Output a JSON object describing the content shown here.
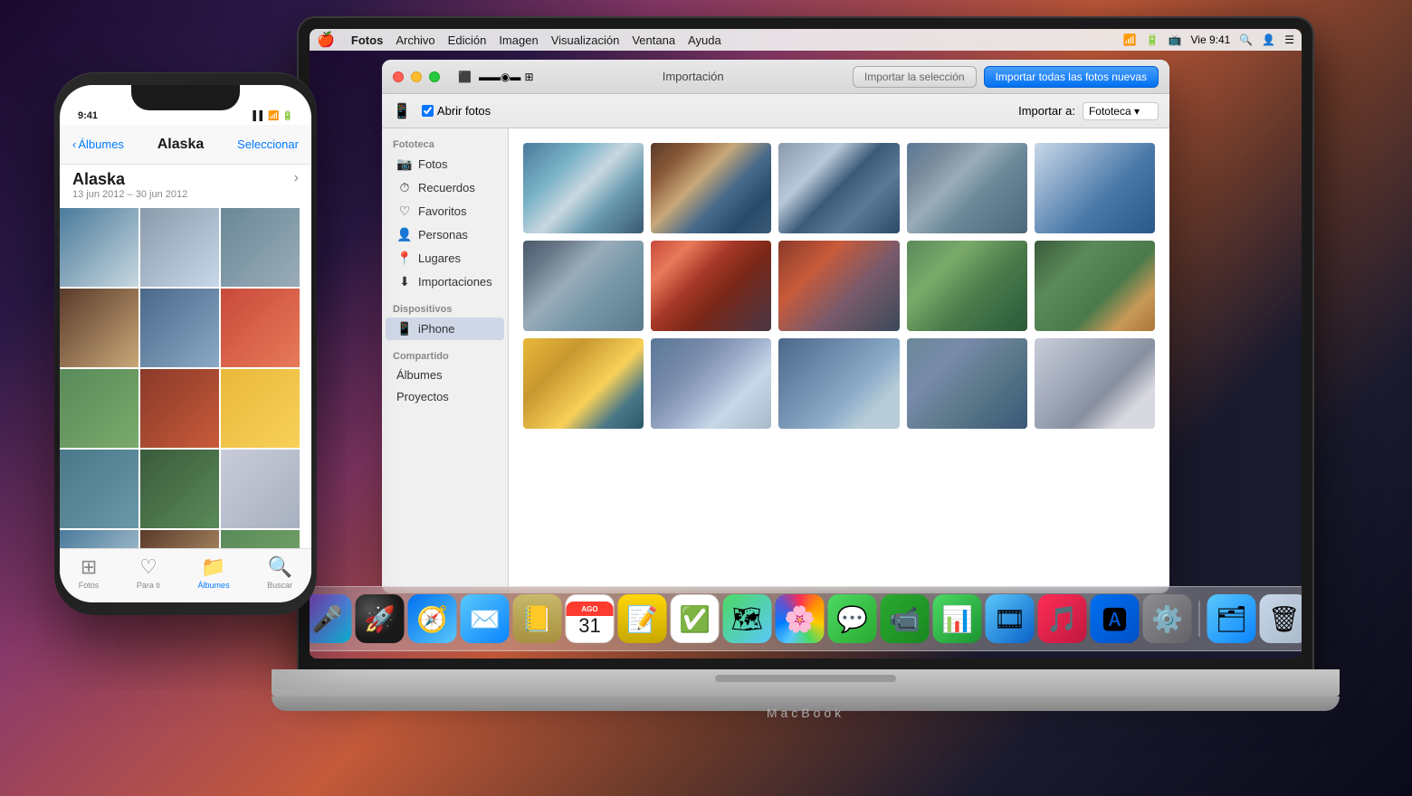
{
  "menubar": {
    "apple": "🍎",
    "items": [
      "Fotos",
      "Archivo",
      "Edición",
      "Imagen",
      "Visualización",
      "Ventana",
      "Ayuda"
    ],
    "app_name": "Fotos",
    "time": "Vie 9:41"
  },
  "window": {
    "title": "Importación",
    "import_selection_label": "Importar la selección",
    "import_all_label": "Importar todas las fotos nuevas",
    "import_to_label": "Importar a:",
    "import_to_value": "Fototeca",
    "open_photos_label": "Abrir fotos"
  },
  "sidebar": {
    "library_header": "Fototeca",
    "library_items": [
      {
        "label": "Fotos",
        "icon": "📷"
      },
      {
        "label": "Recuerdos",
        "icon": "⏱"
      },
      {
        "label": "Favoritos",
        "icon": "♡"
      },
      {
        "label": "Personas",
        "icon": "👤"
      },
      {
        "label": "Lugares",
        "icon": "📍"
      },
      {
        "label": "Importaciones",
        "icon": "⬇"
      }
    ],
    "devices_header": "Dispositivos",
    "devices_items": [
      {
        "label": "iPhone",
        "icon": "📱"
      }
    ],
    "shared_header": "Compartido",
    "shared_items": [
      {
        "label": "Álbumes"
      },
      {
        "label": "Proyectos"
      }
    ]
  },
  "iphone": {
    "time": "9:41",
    "back_label": "Álbumes",
    "title": "Alaska",
    "select_label": "Seleccionar",
    "album_title": "Alaska",
    "album_date": "13 jun 2012 – 30 jun 2012",
    "tabs": [
      {
        "label": "Fotos",
        "icon": "⬛"
      },
      {
        "label": "Para ti",
        "icon": "♡"
      },
      {
        "label": "Álbumes",
        "icon": "📁",
        "active": true
      },
      {
        "label": "Buscar",
        "icon": "🔍"
      }
    ]
  },
  "dock": {
    "items": [
      {
        "name": "siri",
        "emoji": "🎤",
        "class": "dock-siri"
      },
      {
        "name": "launchpad",
        "emoji": "🚀",
        "class": "dock-rocket"
      },
      {
        "name": "safari",
        "emoji": "🧭",
        "class": "dock-safari"
      },
      {
        "name": "mail",
        "emoji": "✉️",
        "class": "dock-mail"
      },
      {
        "name": "contacts",
        "emoji": "📒",
        "class": "dock-contacts"
      },
      {
        "name": "calendar",
        "emoji": "31",
        "class": "dock-calendar"
      },
      {
        "name": "notes",
        "emoji": "📝",
        "class": "dock-notes"
      },
      {
        "name": "reminders",
        "emoji": "✅",
        "class": "dock-reminders"
      },
      {
        "name": "maps",
        "emoji": "🗺",
        "class": "dock-maps"
      },
      {
        "name": "photos",
        "emoji": "🌸",
        "class": "dock-photos"
      },
      {
        "name": "messages",
        "emoji": "💬",
        "class": "dock-messages"
      },
      {
        "name": "facetime",
        "emoji": "📹",
        "class": "dock-facetime"
      },
      {
        "name": "numbers",
        "emoji": "📊",
        "class": "dock-numbers"
      },
      {
        "name": "keynote",
        "emoji": "📐",
        "class": "dock-keynote"
      },
      {
        "name": "itunes",
        "emoji": "🎵",
        "class": "dock-itunes"
      },
      {
        "name": "appstore",
        "emoji": "🅰",
        "class": "dock-appstore"
      },
      {
        "name": "settings",
        "emoji": "⚙️",
        "class": "dock-settings"
      },
      {
        "name": "files",
        "emoji": "🗂",
        "class": "dock-files"
      },
      {
        "name": "trash",
        "emoji": "🗑",
        "class": "dock-trash"
      }
    ]
  },
  "macbook_label": "MacBook"
}
